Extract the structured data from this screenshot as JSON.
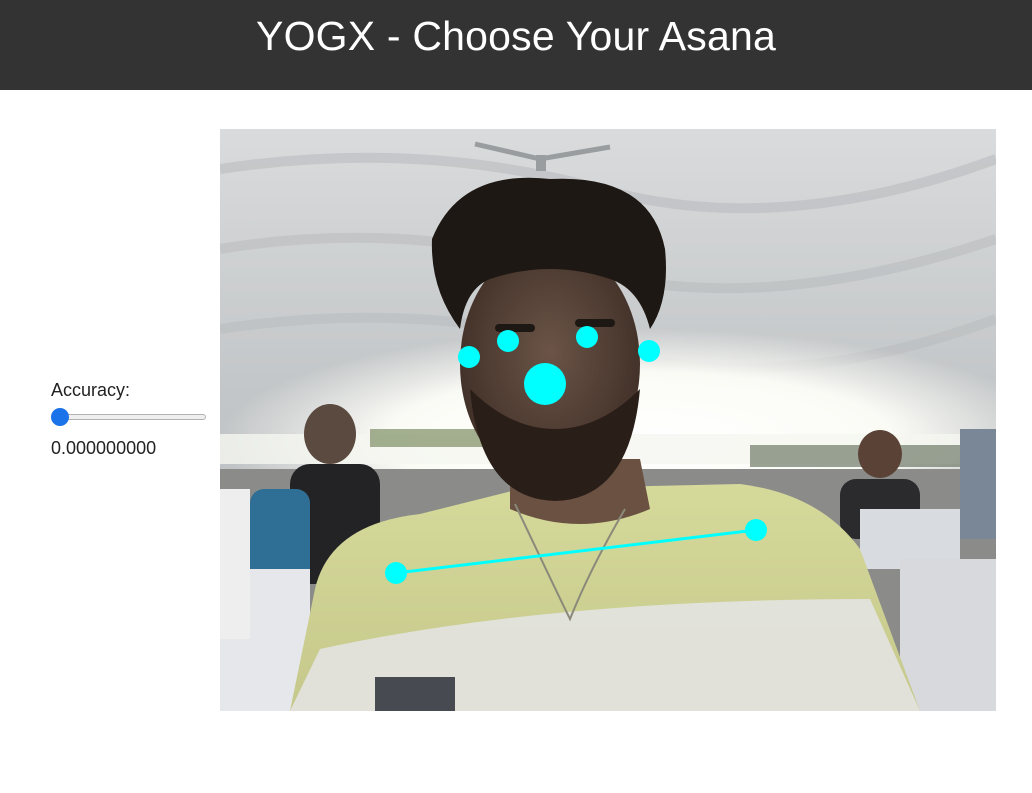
{
  "header": {
    "title": "YOGX - Choose Your Asana"
  },
  "controls": {
    "accuracy_label": "Accuracy:",
    "accuracy_value": "0.000000000",
    "slider_value": 0
  },
  "camera": {
    "keypoint_color": "#00ffff",
    "skeleton_color": "#00ffff",
    "icon": "webcam-feed"
  }
}
